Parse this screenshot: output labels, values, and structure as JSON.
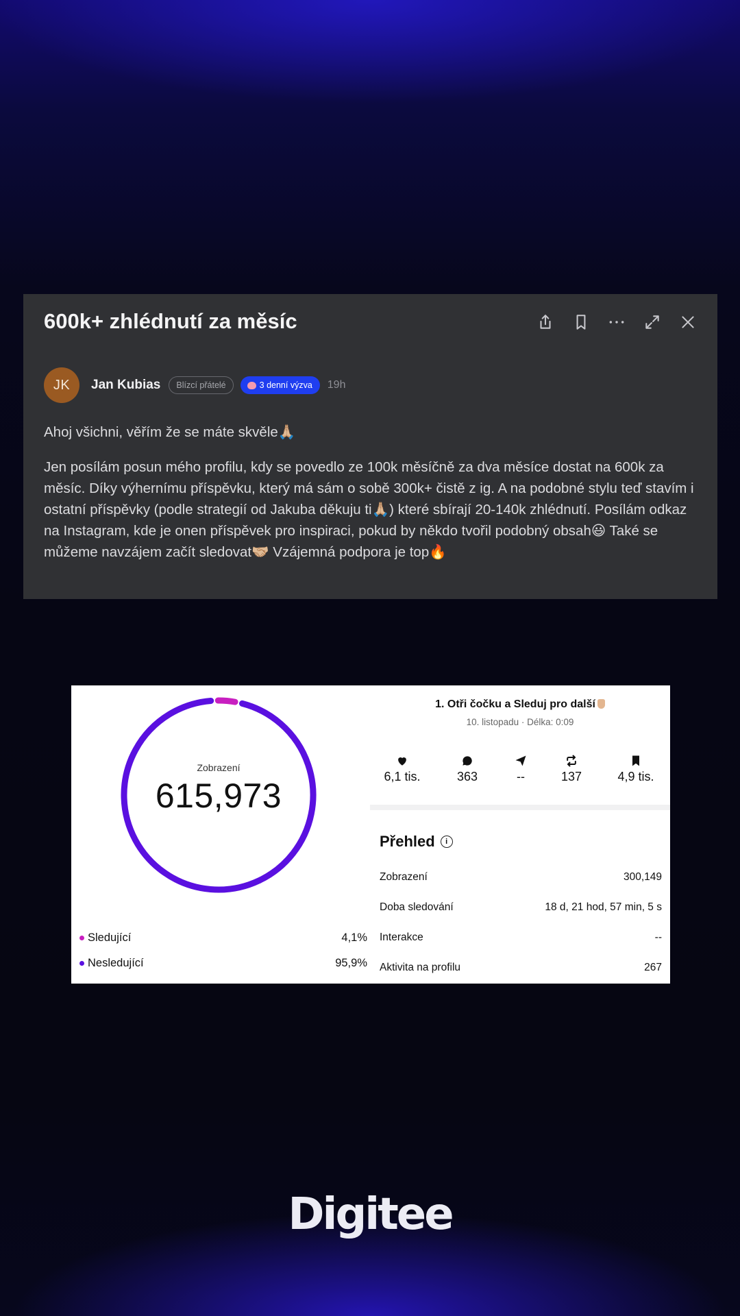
{
  "post": {
    "title": "600k+ zhlédnutí za měsíc",
    "author": {
      "initials": "JK",
      "name": "Jan Kubias",
      "avatar_color": "#9a5a22"
    },
    "badges": {
      "friends": "Blízcí přátelé",
      "challenge": "3 denní výzva"
    },
    "time": "19h",
    "paragraphs": [
      "Ahoj všichni, věřím že se máte skvěle🙏🏼",
      "Jen posílám posun mého profilu, kdy se povedlo ze 100k měsíčně za dva měsíce dostat na 600k za měsíc. Díky výhernímu příspěvku, který má sám o sobě 300k+ čistě z ig. A na podobné stylu teď stavím i ostatní příspěvky (podle strategií od Jakuba děkuju ti🙏🏼) které sbírají 20-140k zhlédnutí. Posílám odkaz na Instagram, kde je onen příspěvek pro inspiraci, pokud by někdo tvořil podobný obsah😃 Také se můžeme navzájem začít sledovat🤝🏼 Vzájemná podpora je top🔥"
    ],
    "actions": [
      "share-icon",
      "bookmark-icon",
      "more-icon",
      "expand-icon",
      "close-icon"
    ]
  },
  "stats": {
    "donut": {
      "label": "Zobrazení",
      "value": "615,973",
      "segments": [
        {
          "name": "Sledující",
          "percent": 4.1,
          "color": "#c81fc0"
        },
        {
          "name": "Nesledující",
          "percent": 95.9,
          "color": "#5a10e0"
        }
      ]
    },
    "legend": [
      {
        "label": "Sledující",
        "value": "4,1%",
        "color": "#c81fc0"
      },
      {
        "label": "Nesledující",
        "value": "95,9%",
        "color": "#5a10e0"
      }
    ],
    "video": {
      "title": "1. Otři čočku a Sleduj pro další",
      "subtitle": "10. listopadu · Délka: 0:09"
    },
    "metrics": [
      {
        "icon": "heart-icon",
        "value": "6,1 tis."
      },
      {
        "icon": "comment-icon",
        "value": "363"
      },
      {
        "icon": "send-icon",
        "value": "--"
      },
      {
        "icon": "repost-icon",
        "value": "137"
      },
      {
        "icon": "save-icon",
        "value": "4,9 tis."
      }
    ],
    "overview": {
      "title": "Přehled",
      "rows": [
        {
          "label": "Zobrazení",
          "value": "300,149"
        },
        {
          "label": "Doba sledování",
          "value": "18 d, 21 hod, 57 min, 5 s"
        },
        {
          "label": "Interakce",
          "value": "--"
        },
        {
          "label": "Aktivita na profilu",
          "value": "267"
        }
      ]
    }
  },
  "brand": {
    "name": "Digitee"
  }
}
